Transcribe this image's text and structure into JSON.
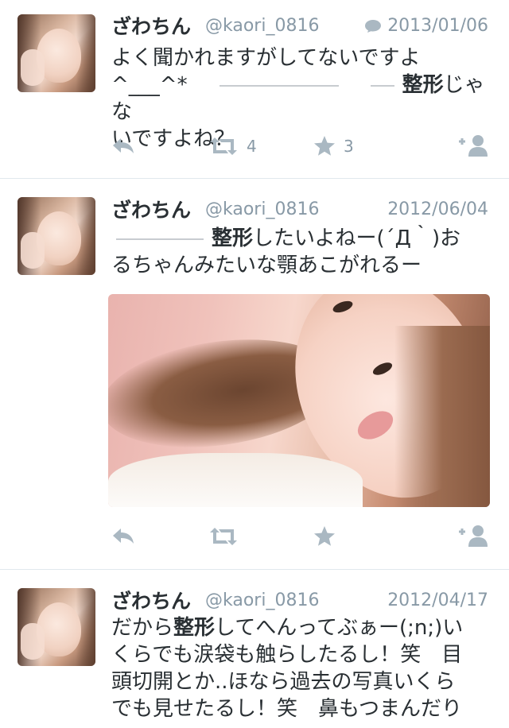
{
  "tweets": [
    {
      "name": "ざわちん",
      "handle": "@kaori_0816",
      "date": "2013/01/06",
      "line1": "よく聞かれますがしてないですよ",
      "line2_a": "^___^*",
      "line2_b": "整形",
      "line2_c": "じゃな",
      "line3": "いですよね？",
      "retweet_count": "4",
      "favorite_count": "3"
    },
    {
      "name": "ざわちん",
      "handle": "@kaori_0816",
      "date": "2012/06/04",
      "line1_a": "整形",
      "line1_b": "したいよねー(´Д｀)お",
      "line2": "るちゃんみたいな顎あこがれるー"
    },
    {
      "name": "ざわちん",
      "handle": "@kaori_0816",
      "date": "2012/04/17",
      "line1_a": "だから",
      "line1_b": "整形",
      "line1_c": "してへんってぶぁー(;n;)い",
      "line2": "くらでも涙袋も触らしたるし！笑　目",
      "line3": "頭切開とか..ほなら過去の写真いくら",
      "line4": "でも見せたるし！笑　鼻もつまんだり"
    }
  ],
  "icons": [
    "reply-icon",
    "retweet-icon",
    "favorite-icon",
    "follow-icon",
    "conversation-icon"
  ],
  "colors": {
    "text": "#292f33",
    "muted": "#8899a6",
    "icon": "#aab8c2",
    "divider": "#e1e8ed"
  }
}
